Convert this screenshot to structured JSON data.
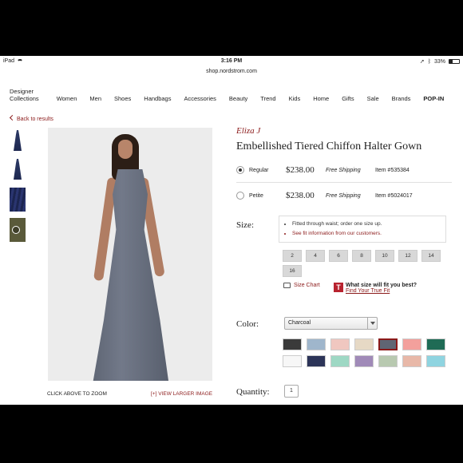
{
  "status": {
    "device": "iPad",
    "time": "3:16 PM",
    "battery": "33%"
  },
  "url": "shop.nordstrom.com",
  "nav": {
    "designer_line1": "Designer",
    "designer_line2": "Collections",
    "items": [
      "Women",
      "Men",
      "Shoes",
      "Handbags",
      "Accessories",
      "Beauty",
      "Trend",
      "Kids",
      "Home",
      "Gifts",
      "Sale",
      "Brands"
    ],
    "popin": "POP-IN"
  },
  "back": "Back to results",
  "gallery": {
    "thumbs": [
      "dress-front-thumbnail",
      "dress-alt-thumbnail",
      "fabric-detail-thumbnail",
      "video-thumbnail"
    ],
    "zoom_hint": "CLICK ABOVE TO ZOOM",
    "larger_link": "[+] VIEW LARGER IMAGE"
  },
  "product": {
    "brand": "Eliza J",
    "title": "Embellished Tiered Chiffon Halter Gown",
    "options": [
      {
        "name": "Regular",
        "price": "$238.00",
        "shipping": "Free Shipping",
        "item": "Item #535384",
        "selected": true
      },
      {
        "name": "Petite",
        "price": "$238.00",
        "shipping": "Free Shipping",
        "item": "Item #5024017",
        "selected": false
      }
    ]
  },
  "size": {
    "label": "Size:",
    "tips": [
      "Fitted through waist; order one size up.",
      "See fit information from our customers."
    ],
    "options": [
      "2",
      "4",
      "6",
      "8",
      "10",
      "12",
      "14",
      "16"
    ],
    "size_chart": "Size Chart",
    "truefit_question": "What size will fit you best?",
    "truefit_link": "Find Your True Fit",
    "truefit_logo": "T"
  },
  "color": {
    "label": "Color:",
    "selected": "Charcoal",
    "swatches": [
      {
        "name": "black",
        "color": "#3a3a3a"
      },
      {
        "name": "sky-blue",
        "color": "#9fb6cc"
      },
      {
        "name": "blush",
        "color": "#f0c7c0"
      },
      {
        "name": "champagne",
        "color": "#e6d9c5"
      },
      {
        "name": "charcoal",
        "color": "#5f6573",
        "selected": true
      },
      {
        "name": "coral",
        "color": "#f3a09c"
      },
      {
        "name": "emerald",
        "color": "#1f6b55"
      },
      {
        "name": "white",
        "color": "#f7f7f7"
      },
      {
        "name": "navy",
        "color": "#2c3458"
      },
      {
        "name": "mint",
        "color": "#9ed8c4"
      },
      {
        "name": "lavender",
        "color": "#a08ab8"
      },
      {
        "name": "sage",
        "color": "#b8c9b0"
      },
      {
        "name": "peach",
        "color": "#e8b8a8"
      },
      {
        "name": "aqua",
        "color": "#8fd4e0"
      }
    ]
  },
  "quantity": {
    "label": "Quantity:",
    "value": "1"
  }
}
